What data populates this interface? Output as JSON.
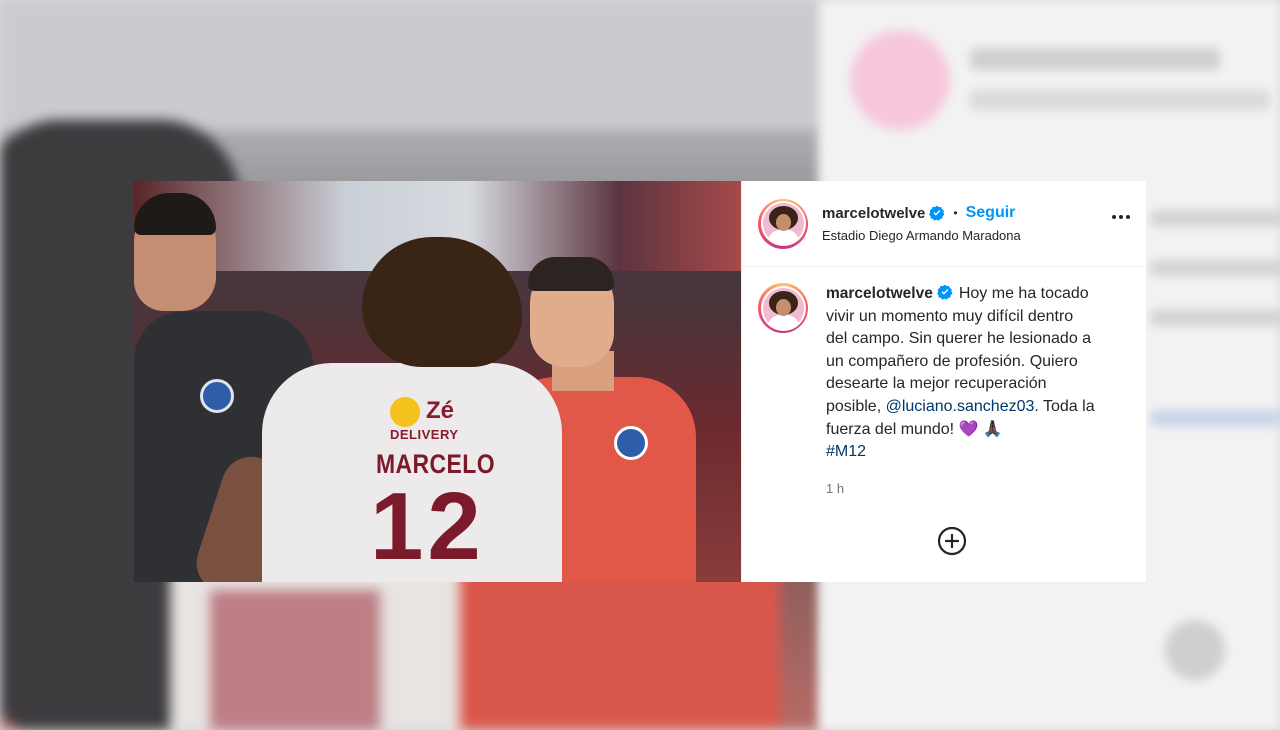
{
  "post": {
    "username": "marcelotwelve",
    "follow_label": "Seguir",
    "separator": "•",
    "location": "Estadio Diego Armando Maradona",
    "caption_lines": [
      "Hoy me ha tocado",
      "vivir un momento muy difícil dentro",
      "del campo. Sin querer he lesionado a",
      "un compañero de profesión. Quiero",
      "desearte la mejor recuperación"
    ],
    "caption_pre_mention": "posible,",
    "mention": "@luciano.sanchez03",
    "caption_post_mention": ". Toda la",
    "caption_last": "fuerza del mundo!",
    "emojis": "💜 🙏🏿",
    "hashtag": "#M12",
    "time": "1 h"
  },
  "jersey": {
    "sponsor": "Zé",
    "sponsor_sub": "DELIVERY",
    "name": "MARCELO",
    "number": "12"
  },
  "icons": {
    "verified": "verified-badge-icon",
    "more": "more-options-icon",
    "add": "add-circle-icon"
  },
  "colors": {
    "link": "#0095f6",
    "mention": "#00376b",
    "text": "#262626",
    "secondary": "#737373"
  }
}
